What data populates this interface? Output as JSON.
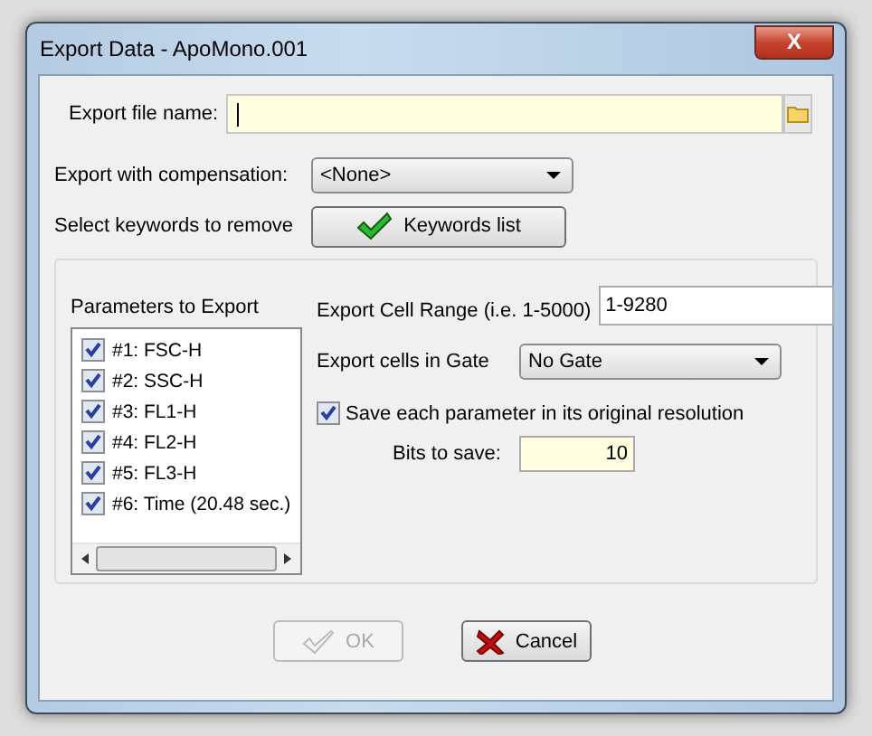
{
  "window": {
    "title": "Export Data - ApoMono.001",
    "close": "X"
  },
  "file_name": {
    "label": "Export file name:"
  },
  "compensation": {
    "label": "Export with compensation:",
    "value": "<None>"
  },
  "keywords": {
    "label": "Select keywords to remove",
    "button": "Keywords list"
  },
  "parameters": {
    "label": "Parameters to Export",
    "items": [
      {
        "label": "#1: FSC-H",
        "checked": true
      },
      {
        "label": "#2: SSC-H",
        "checked": true
      },
      {
        "label": "#3: FL1-H",
        "checked": true
      },
      {
        "label": "#4: FL2-H",
        "checked": true
      },
      {
        "label": "#5: FL3-H",
        "checked": true
      },
      {
        "label": "#6: Time (20.48 sec.)",
        "checked": true
      }
    ]
  },
  "cell_range": {
    "label": "Export Cell Range (i.e. 1-5000)",
    "value": "1-9280"
  },
  "gate": {
    "label": "Export cells in Gate",
    "value": "No Gate"
  },
  "original_resolution": {
    "label": "Save each parameter in its original resolution",
    "checked": true
  },
  "bits": {
    "label": "Bits to save:",
    "value": "10"
  },
  "buttons": [
    {
      "kind": "ok",
      "label": "OK",
      "disabled": true
    },
    {
      "kind": "cancel",
      "label": "Cancel",
      "disabled": false
    }
  ]
}
